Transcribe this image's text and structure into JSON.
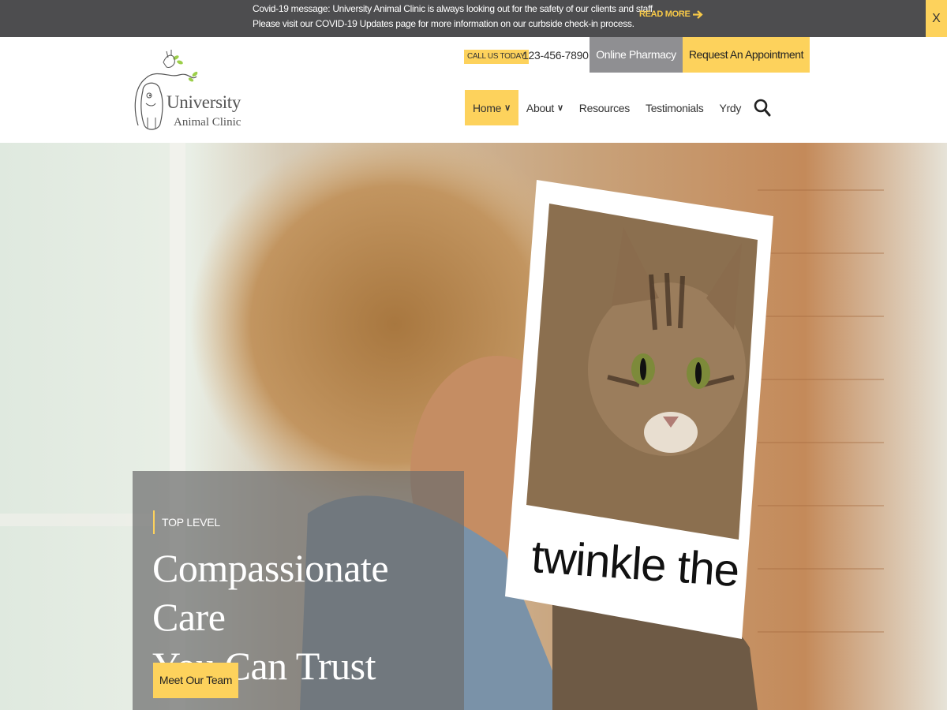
{
  "banner": {
    "line1": "Covid-19 message: University Animal Clinic is always looking out for the safety of our clients and staff.",
    "line2": "Please visit our COVID-19 Updates page for more information on our curbside check-in process.",
    "read_more": "READ MORE",
    "close": "X"
  },
  "logo": {
    "title": "University",
    "subtitle": "Animal Clinic"
  },
  "contact": {
    "call_label": "CALL US TODAY",
    "phone": "123-456-7890"
  },
  "buttons": {
    "pharmacy": "Online Pharmacy",
    "appointment": "Request An Appointment"
  },
  "nav": {
    "home": "Home",
    "about": "About",
    "resources": "Resources",
    "testimonials": "Testimonials",
    "yrdy": "Yrdy"
  },
  "hero": {
    "polaroid_caption": "twinkle the",
    "kicker": "TOP LEVEL",
    "headline_line1": "Compassionate Care",
    "headline_line2": "You Can Trust",
    "cta": "Meet Our Team"
  },
  "colors": {
    "accent": "#fdd25c",
    "banner_bg": "#4d4d4f",
    "pharmacy_bg": "#8f8f92"
  },
  "icons": {
    "read_more": "arrow-right-icon",
    "nav_dropdown": "chevron-down-icon",
    "search": "search-icon",
    "close": "close-icon"
  }
}
